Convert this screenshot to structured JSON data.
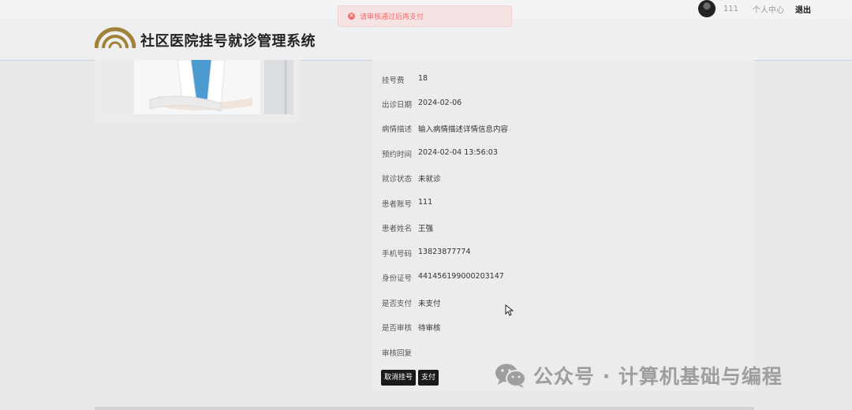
{
  "toast": {
    "message": "请审核通过后再支付",
    "icon": "error-circle-icon",
    "color": "#f56c6c"
  },
  "topbar": {
    "user_name": "111",
    "profile_label": "个人中心",
    "logout_label": "退出"
  },
  "header": {
    "title": "社区医院挂号就诊管理系统",
    "logo_color": "#a0823a"
  },
  "details": [
    {
      "label": "挂号费",
      "value": "18"
    },
    {
      "label": "出诊日期",
      "value": "2024-02-06"
    },
    {
      "label": "病情描述",
      "value": "输入病情描述详情信息内容"
    },
    {
      "label": "预约时间",
      "value": "2024-02-04 13:56:03"
    },
    {
      "label": "就诊状态",
      "value": "未就诊"
    },
    {
      "label": "患者账号",
      "value": "111"
    },
    {
      "label": "患者姓名",
      "value": "王强"
    },
    {
      "label": "手机号码",
      "value": "13823877774"
    },
    {
      "label": "身份证号",
      "value": "441456199000203147"
    },
    {
      "label": "是否支付",
      "value": "未支付"
    },
    {
      "label": "是否审核",
      "value": "待审核"
    },
    {
      "label": "审核回复",
      "value": ""
    }
  ],
  "actions": {
    "cancel_label": "取消挂号",
    "pay_label": "支付"
  },
  "watermark": {
    "text": "公众号 · 计算机基础与编程",
    "icon": "wechat-icon"
  }
}
